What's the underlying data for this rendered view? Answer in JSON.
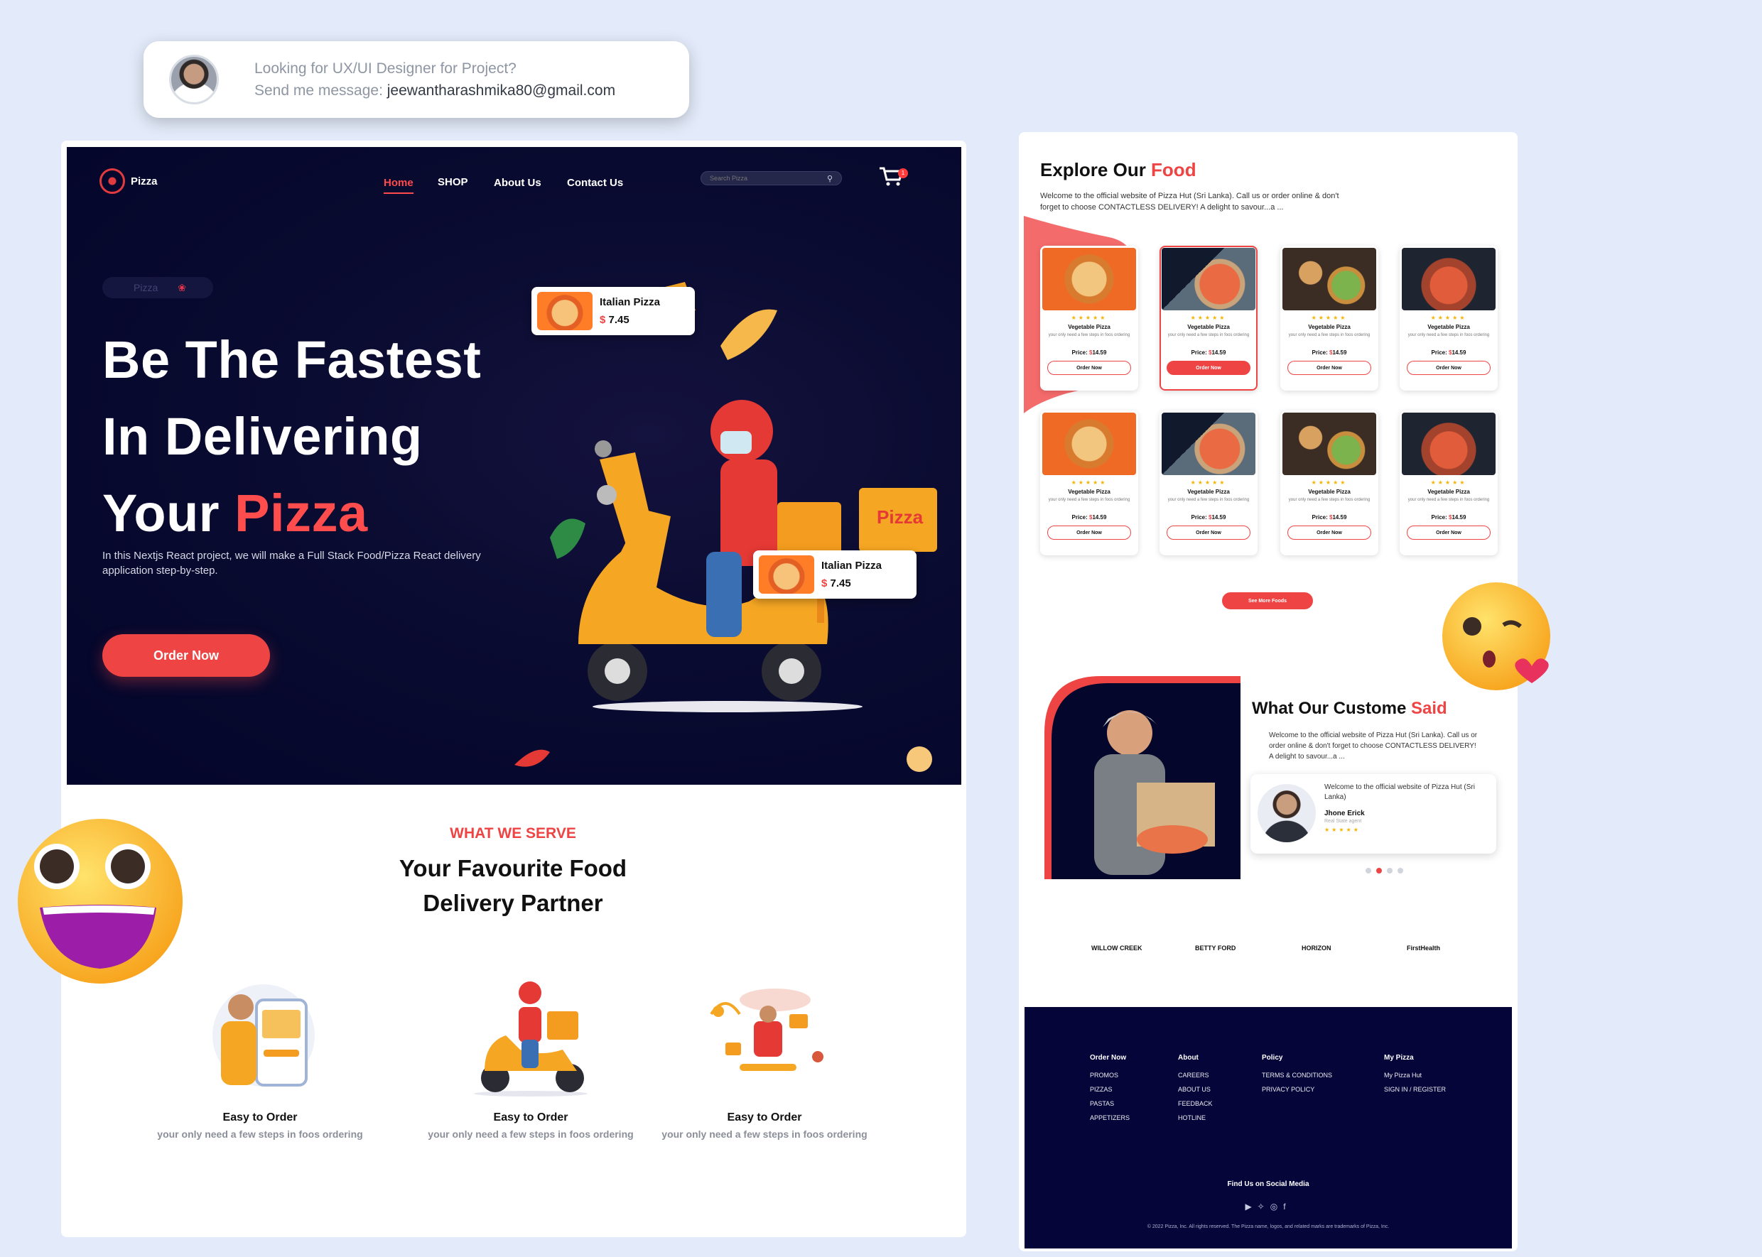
{
  "contact": {
    "line1": "Looking for UX/UI Designer for Project?",
    "line2_prefix": "Send me message: ",
    "email": "jeewantharashmika80@gmail.com"
  },
  "nav": {
    "logo": "Pizza",
    "items": [
      "Home",
      "SHOP",
      "About Us",
      "Contact Us"
    ],
    "active": "Home",
    "search_placeholder": "Search Pizza",
    "cart_count": "1"
  },
  "hero": {
    "tag": "Pizza",
    "title_line1": "Be The Fastest",
    "title_line2": "In Delivering",
    "title_line3_prefix": "Your ",
    "title_line3_accent": "Pizza",
    "subtitle": "In this Nextjs React project, we will make a Full Stack Food/Pizza React delivery application step-by-step.",
    "cta": "Order Now",
    "cards": [
      {
        "name": "Italian Pizza",
        "currency": "$",
        "price": "7.45"
      },
      {
        "name": "Italian Pizza",
        "currency": "$",
        "price": "7.45"
      }
    ]
  },
  "serve": {
    "eyebrow": "WHAT WE SERVE",
    "title_line1": "Your Favourite Food",
    "title_line2": "Delivery Partner",
    "features": [
      {
        "title": "Easy to Order",
        "desc": "your only need a few steps in foos ordering"
      },
      {
        "title": "Easy to Order",
        "desc": "your only need a few steps in foos ordering"
      },
      {
        "title": "Easy to Order",
        "desc": "your only need a few steps in foos ordering"
      }
    ]
  },
  "explore": {
    "title_prefix": "Explore Our ",
    "title_accent": "Food",
    "subtitle": "Welcome to the official website of Pizza Hut (Sri Lanka). Call us or order online & don't forget to choose CONTACTLESS DELIVERY! A delight to savour...a ...",
    "cards": [
      {
        "title": "Vegetable Pizza",
        "desc": "your only need a few steps in foos ordering",
        "price_label": "Price: ",
        "currency": "$",
        "price": "14.59",
        "button": "Order Now",
        "rating": 5
      },
      {
        "title": "Vegetable Pizza",
        "desc": "your only need a few steps in foos ordering",
        "price_label": "Price: ",
        "currency": "$",
        "price": "14.59",
        "button": "Order Now",
        "rating": 5
      },
      {
        "title": "Vegetable Pizza",
        "desc": "your only need a few steps in foos ordering",
        "price_label": "Price: ",
        "currency": "$",
        "price": "14.59",
        "button": "Order Now",
        "rating": 5
      },
      {
        "title": "Vegetable Pizza",
        "desc": "your only need a few steps in foos ordering",
        "price_label": "Price: ",
        "currency": "$",
        "price": "14.59",
        "button": "Order Now",
        "rating": 5
      },
      {
        "title": "Vegetable Pizza",
        "desc": "your only need a few steps in foos ordering",
        "price_label": "Price: ",
        "currency": "$",
        "price": "14.59",
        "button": "Order Now",
        "rating": 5
      },
      {
        "title": "Vegetable Pizza",
        "desc": "your only need a few steps in foos ordering",
        "price_label": "Price: ",
        "currency": "$",
        "price": "14.59",
        "button": "Order Now",
        "rating": 5
      },
      {
        "title": "Vegetable Pizza",
        "desc": "your only need a few steps in foos ordering",
        "price_label": "Price: ",
        "currency": "$",
        "price": "14.59",
        "button": "Order Now",
        "rating": 5
      },
      {
        "title": "Vegetable Pizza",
        "desc": "your only need a few steps in foos ordering",
        "price_label": "Price: ",
        "currency": "$",
        "price": "14.59",
        "button": "Order Now",
        "rating": 5
      }
    ],
    "active_card": 1,
    "see_more": "See More Foods"
  },
  "testimonial": {
    "title_prefix": "What Our Custome ",
    "title_accent": "Said",
    "text": "Welcome to the official website of Pizza Hut (Sri Lanka). Call us or order online & don't forget to choose CONTACTLESS DELIVERY! A delight to savour...a ...",
    "review_text": "Welcome to the official website of Pizza Hut (Sri Lanka)",
    "reviewer": "Jhone Erick",
    "reviewer_role": "Real State agent",
    "rating": 5,
    "active_dot": 1,
    "dot_count": 4
  },
  "partners": [
    "WILLOW CREEK",
    "BETTY FORD",
    "HORIZON",
    "FirstHealth"
  ],
  "footer": {
    "columns": [
      {
        "heading": "Order Now",
        "links": [
          "PROMOS",
          "PIZZAS",
          "PASTAS",
          "APPETIZERS"
        ]
      },
      {
        "heading": "About",
        "links": [
          "CAREERS",
          "ABOUT US",
          "FEEDBACK",
          "HOTLINE"
        ]
      },
      {
        "heading": "Policy",
        "links": [
          "TERMS & CONDITIONS",
          "PRIVACY POLICY"
        ]
      },
      {
        "heading": "My Pizza",
        "links": [
          "My Pizza Hut",
          "SIGN IN / REGISTER"
        ]
      }
    ],
    "social_heading": "Find Us on Social Media",
    "socials": [
      "youtube-icon",
      "twitter-icon",
      "instagram-icon",
      "facebook-icon"
    ],
    "copyright": "© 2022 Pizza, Inc. All rights reserved. The Pizza name, logos, and related marks are trademarks of Pizza, Inc."
  },
  "colors": {
    "accent": "#ef4444",
    "hero_bg": "#05062b",
    "footer_bg": "#05053a",
    "star": "#f5b301"
  }
}
